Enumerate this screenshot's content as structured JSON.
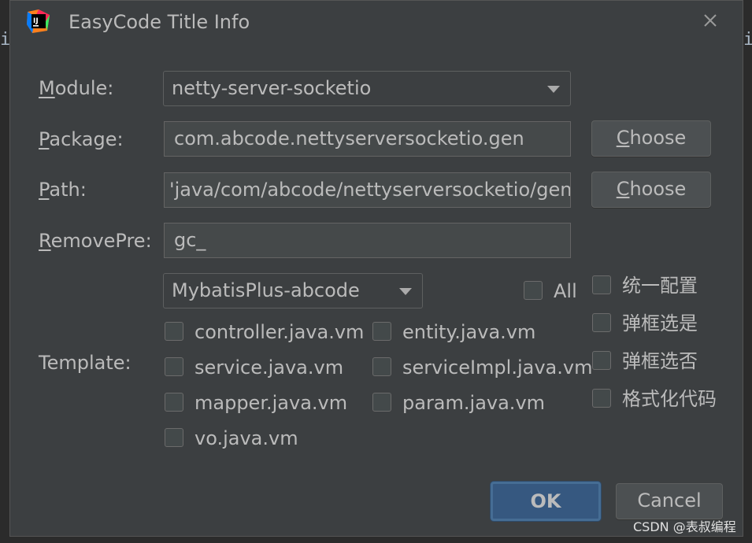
{
  "background": {
    "left_glyph": "i",
    "right_glyph": "i"
  },
  "dialog": {
    "title": "EasyCode Title Info",
    "icon": "intellij-idea-icon",
    "close_icon": "close-icon"
  },
  "form": {
    "module": {
      "label_mnemonic": "M",
      "label_rest": "odule:",
      "value": "netty-server-socketio"
    },
    "package": {
      "label_mnemonic": "P",
      "label_rest": "ackage:",
      "value": "com.abcode.nettyserversocketio.gen",
      "button_mnemonic": "C",
      "button_rest": "hoose"
    },
    "path": {
      "label_mnemonic": "P",
      "label_rest": "ath:",
      "value": "'java/com/abcode/nettyserversocketio/gen",
      "button_mnemonic": "C",
      "button_rest": "hoose"
    },
    "remove_pre": {
      "label_mnemonic": "R",
      "label_rest": "emovePre:",
      "value": "gc_"
    },
    "template": {
      "label": "Template:",
      "group_select": "MybatisPlus-abcode",
      "all_label": "All",
      "all_checked": false,
      "files": [
        {
          "name": "controller.java.vm",
          "checked": false
        },
        {
          "name": "entity.java.vm",
          "checked": false
        },
        {
          "name": "service.java.vm",
          "checked": false
        },
        {
          "name": "serviceImpl.java.vm",
          "checked": false
        },
        {
          "name": "mapper.java.vm",
          "checked": false
        },
        {
          "name": "param.java.vm",
          "checked": false
        },
        {
          "name": "vo.java.vm",
          "checked": false
        }
      ]
    },
    "options": [
      {
        "label": "统一配置",
        "checked": false
      },
      {
        "label": "弹框选是",
        "checked": false
      },
      {
        "label": "弹框选否",
        "checked": false
      },
      {
        "label": "格式化代码",
        "checked": false
      }
    ]
  },
  "footer": {
    "ok_label": "OK",
    "cancel_label": "Cancel"
  },
  "watermark": "CSDN @表叔编程",
  "colors": {
    "dialog_bg": "#3c3f41",
    "field_bg": "#45494a",
    "ok_button": "#365880",
    "text": "#bbbbbb"
  }
}
